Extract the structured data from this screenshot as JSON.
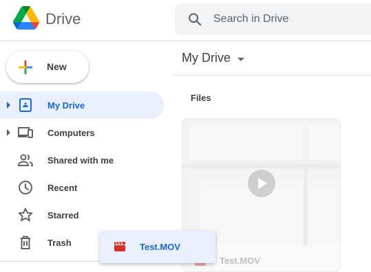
{
  "app": {
    "name": "Drive"
  },
  "search": {
    "placeholder": "Search in Drive"
  },
  "new_button": {
    "label": "New"
  },
  "nav": {
    "items": [
      {
        "label": "My Drive",
        "icon": "my-drive-icon",
        "active": true,
        "expandable": true
      },
      {
        "label": "Computers",
        "icon": "computers-icon",
        "active": false,
        "expandable": true
      },
      {
        "label": "Shared with me",
        "icon": "shared-with-me-icon",
        "active": false,
        "expandable": false
      },
      {
        "label": "Recent",
        "icon": "clock-icon",
        "active": false,
        "expandable": false
      },
      {
        "label": "Starred",
        "icon": "star-icon",
        "active": false,
        "expandable": false
      },
      {
        "label": "Trash",
        "icon": "trash-icon",
        "active": false,
        "expandable": false
      }
    ]
  },
  "content": {
    "title": "My Drive",
    "section_label": "Files",
    "files": [
      {
        "name": "Test.MOV",
        "type": "video"
      }
    ]
  },
  "drag": {
    "file_name": "Test.MOV"
  },
  "colors": {
    "accent": "#1967d2",
    "active_bg": "#e8f0fe",
    "video_icon": "#d93025"
  }
}
